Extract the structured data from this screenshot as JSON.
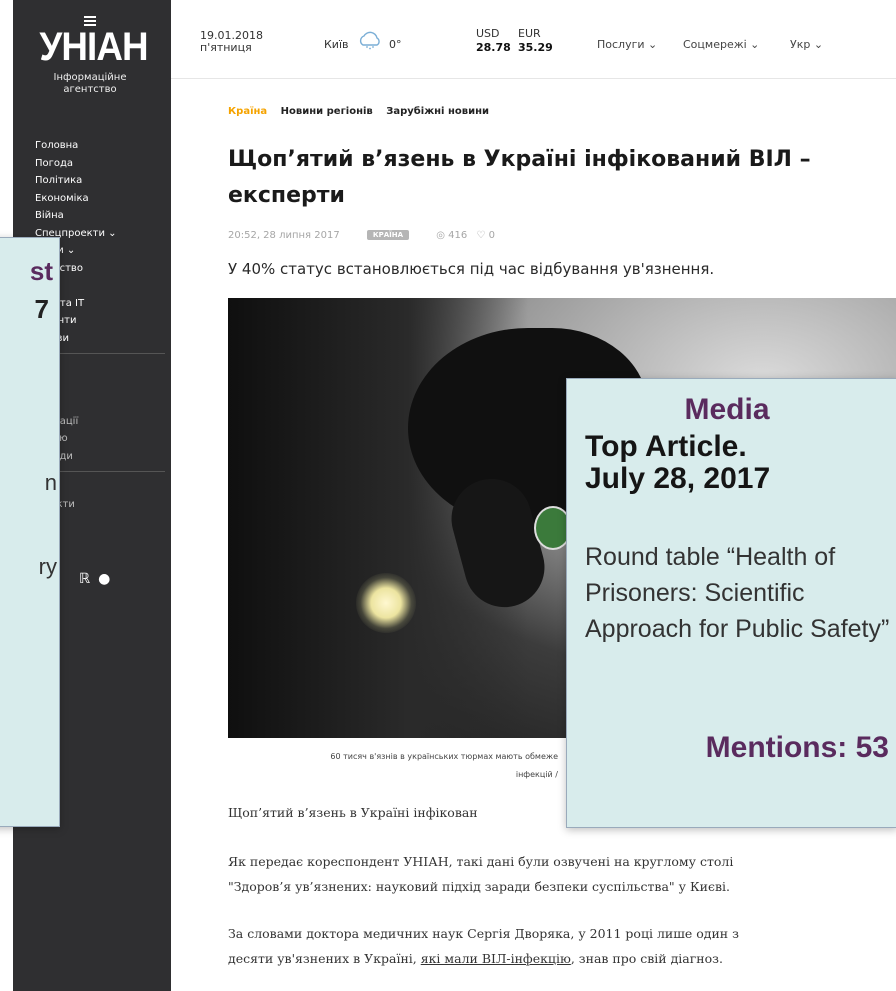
{
  "sidebar": {
    "logo_word": "УНІАН",
    "logo_sub_1": "Інформаційне",
    "logo_sub_2": "агентство",
    "items": [
      "Головна",
      "Погода",
      "Політика",
      "Економіка",
      "Війна",
      "Спецпроекти ⌄",
      "...они ⌄",
      "...ільство",
      "...рт",
      "",
      "...ка та IT",
      "...денти",
      "...йози"
    ],
    "items_lower": [
      "...о",
      "...о",
      "...ки",
      "...лікації",
      "...ов'ю",
      "...тріди"
    ],
    "items_bottom": [
      "...в",
      "...такти"
    ]
  },
  "topbar": {
    "date": "19.01.2018",
    "weekday": "п'ятниця",
    "city": "Київ",
    "temp": "0°",
    "usd_label": "USD",
    "usd_value": "28.78",
    "eur_label": "EUR",
    "eur_value": "35.29",
    "menu_services": "Послуги ⌄",
    "menu_social": "Соцмережі ⌄",
    "menu_lang": "Укр ⌄"
  },
  "breadcrumbs": {
    "active": "Країна",
    "item2": "Новини регіонів",
    "item3": "Зарубіжні новини"
  },
  "article": {
    "title_line1": "Щоп’ятий в’язень в Україні інфікований ВІЛ –",
    "title_line2": "експерти",
    "datetime": "20:52, 28 липня 2017",
    "tag": "КРАЇНА",
    "views": "◎ 416",
    "comments": "♡ 0",
    "lead": "У 40% статус встановлюється під час відбування ув'язнення.",
    "caption_line1": "60 тисяч в'язнів в українських тюрмах мають обмеже",
    "caption_line2": "інфекцій /",
    "para1": "Щоп’ятий в’язень в Україні інфікован",
    "para2_line1": "Як передає кореспондент УНІАН, такі дані були озвучені на круглому столі",
    "para2_line2": "\"Здоров’я ув’язнених: науковий підхід заради безпеки суспільства\" у Києві.",
    "para3_line1a": "За словами доктора медичних наук Сергія Дворяка, у 2011 році лише один з",
    "para3_line2a": "десяти ув'язнених в Україні, ",
    "para3_link": "які мали ВІЛ-інфекцію",
    "para3_line2b": ", знав про свій діагноз."
  },
  "left_card": {
    "t1": "st",
    "t2": "7",
    "t3": "n",
    "t4": "ry"
  },
  "right_card": {
    "media": "Media",
    "top_line1": "Top Article.",
    "top_line2": "July 28, 2017",
    "body": "Round table “Health of Prisoners: Scientific Approach for Public Safety”",
    "mentions": "Mentions: 53"
  }
}
